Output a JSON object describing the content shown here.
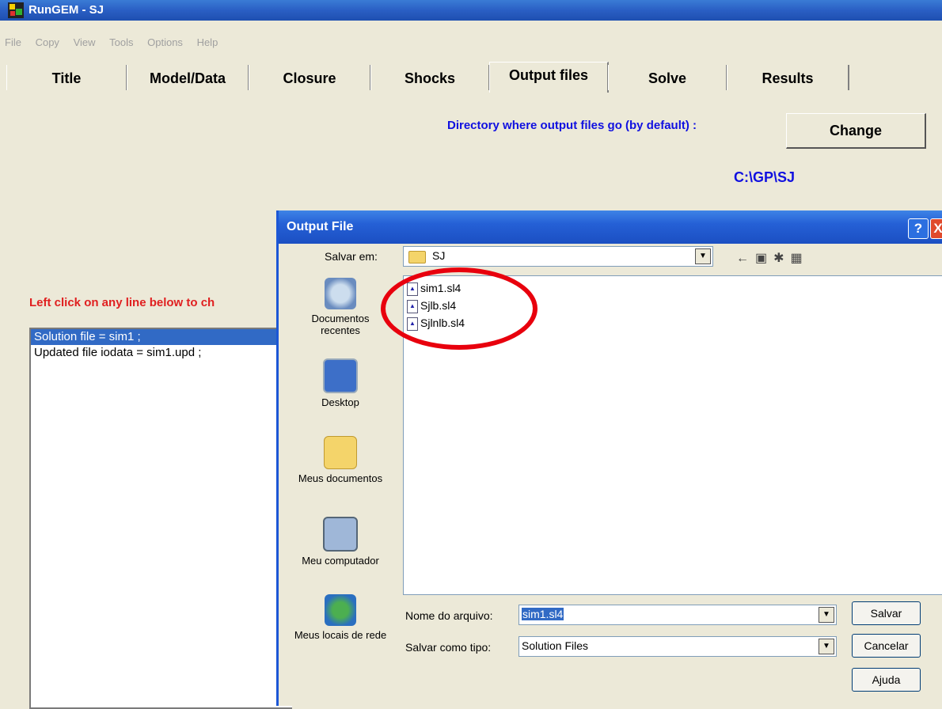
{
  "window": {
    "title": "RunGEM - SJ"
  },
  "menu": [
    "File",
    "Copy",
    "View",
    "Tools",
    "Options",
    "Help"
  ],
  "tabs": [
    "Title",
    "Model/Data",
    "Closure",
    "Shocks",
    "Output files",
    "Solve",
    "Results"
  ],
  "active_tab": "Output files",
  "output": {
    "dir_label": "Directory where output files go (by default) :",
    "change_button": "Change",
    "dir_path": "C:\\GP\\SJ",
    "instruction": "Left click on any line below to ch",
    "lines": [
      "Solution file = sim1 ;",
      "Updated file iodata = sim1.upd ;"
    ]
  },
  "dialog": {
    "title": "Output File",
    "help": "?",
    "close": "X",
    "save_in_label": "Salvar em:",
    "save_in_value": "SJ",
    "places": [
      "Documentos recentes",
      "Desktop",
      "Meus documentos",
      "Meu computador",
      "Meus locais de rede"
    ],
    "files": [
      "sim1.sl4",
      "Sjlb.sl4",
      "Sjlnlb.sl4"
    ],
    "filename_label": "Nome do arquivo:",
    "filename_value": "sim1.sl4",
    "filetype_label": "Salvar como tipo:",
    "filetype_value": "Solution Files",
    "buttons": {
      "save": "Salvar",
      "cancel": "Cancelar",
      "help": "Ajuda"
    }
  },
  "colors": {
    "title_blue": "#2a5fc4",
    "link_blue": "#1010e0",
    "warning_red": "#e02020",
    "highlight_circle": "#e8000d",
    "selection": "#316ac5"
  }
}
